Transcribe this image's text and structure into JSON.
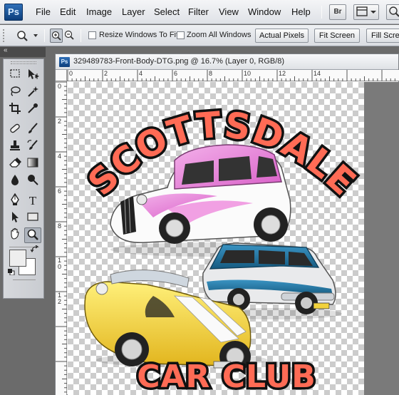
{
  "app": {
    "logo": "Ps"
  },
  "menu": [
    "File",
    "Edit",
    "Image",
    "Layer",
    "Select",
    "Filter",
    "View",
    "Window",
    "Help"
  ],
  "app_buttons": {
    "bridge": "Br"
  },
  "options": {
    "resize_windows": "Resize Windows To Fit",
    "zoom_all_windows": "Zoom All Windows",
    "actual_pixels": "Actual Pixels",
    "fit_screen": "Fit Screen",
    "fill_screen": "Fill Scre"
  },
  "panel": {
    "collapse": "«"
  },
  "document": {
    "icon": "Ps",
    "title": "329489783-Front-Body-DTG.png @ 16.7% (Layer 0, RGB/8)",
    "ruler_top": [
      "0",
      "2",
      "4",
      "6",
      "8",
      "10",
      "12",
      "14"
    ],
    "ruler_left": [
      "0",
      "2",
      "4",
      "6",
      "8",
      "1\n0",
      "1\n2"
    ]
  },
  "artwork": {
    "top_text": "SCOTTSDALE",
    "bottom_text": "CAR CLUB"
  },
  "colors": {
    "text_fill": "#ff6b55",
    "text_stroke": "#111111",
    "pink": "#e88adc",
    "yellow": "#f2d23c",
    "teal": "#1f6e97"
  }
}
